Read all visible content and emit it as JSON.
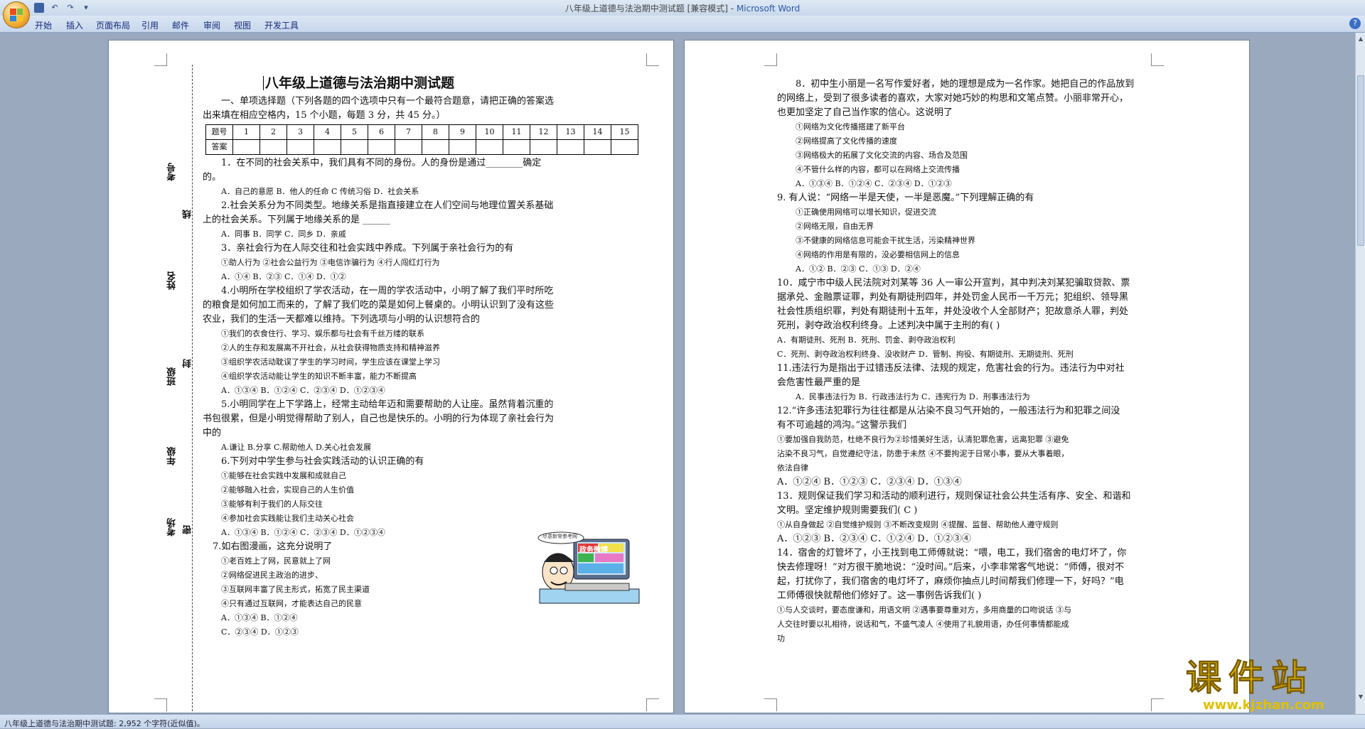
{
  "window": {
    "doc_name": "八年级上道德与法治期中测试题 [兼容模式]",
    "separator": " - ",
    "app_name": "Microsoft Word"
  },
  "menu": [
    "开始",
    "插入",
    "页面布局",
    "引用",
    "邮件",
    "审阅",
    "视图",
    "开发工具"
  ],
  "status": {
    "text": "八年级上道德与法治期中测试题: 2,952 个字符(近似值)。"
  },
  "binding": [
    "考号",
    "线",
    "姓名",
    "班级",
    "封",
    "年级",
    "考场",
    "密"
  ],
  "page1": {
    "title": "八年级上道德与法治期中测试题",
    "section1_line1": "一、单项选择题（下列各题的四个选项中只有一个最符合题意，请把正确的答案选",
    "section1_line2": "出来填在相应空格内，15 个小题，每题 3 分，共 45 分。）",
    "table_row1_head": "题号",
    "table_row2_head": "答案",
    "table_numbers": [
      "1",
      "2",
      "3",
      "4",
      "5",
      "6",
      "7",
      "8",
      "9",
      "10",
      "11",
      "12",
      "13",
      "14",
      "15"
    ],
    "q1_a": "1．在不同的社会关系中，我们具有不同的身份。人的身份是通过________确定",
    "q1_b": "的。",
    "q1_opts": "A．自己的意愿   B．他人的任命     C 传统习俗   D．社会关系",
    "q2_a": "2.社会关系分为不同类型。地缘关系是指直接建立在人们空间与地理位置关系基础",
    "q2_b": "上的社会关系。下列属于地缘关系的是 ______",
    "q2_opts": "A．同事 B．同学     C．同乡     D．亲戚",
    "q3_a": "3．亲社会行为在人际交往和社会实践中养成。下列属于亲社会行为的有",
    "q3_b": "①助人行为      ②社会公益行为      ③电信诈骗行为        ④行人闯红灯行为",
    "q3_opts": "A．①④          B．②③          C．①④          D．①②",
    "q4_a": "4.小明所在学校组织了学农活动，在一周的学农活动中，小明了解了我们平时所吃",
    "q4_b": "的粮食是如何加工而来的，了解了我们吃的菜是如何上餐桌的。小明认识到了没有这些",
    "q4_c": "农业，我们的生活一天都难以维持。下列选项与小明的认识想符合的",
    "q4_i1": "①我们的衣食住行、学习、娱乐都与社会有千丝万缕的联系",
    "q4_i2": "②人的生存和发展离不开社会，从社会获得物质支持和精神滋养",
    "q4_i3": "③组织学农活动耽误了学生的学习时间，学生应该在课堂上学习",
    "q4_i4": "④组织学农活动能让学生的知识不断丰富，能力不断提高",
    "q4_opts": "A．①③④          B．①②④          C．②③④          D．①②③④",
    "q5_a": "5.小明同学在上下学路上，经常主动给年迈和需要帮助的人让座。虽然背着沉重的",
    "q5_b": "书包很累，但是小明觉得帮助了别人，自己也是快乐的。小明的行为体现了亲社会行为",
    "q5_c": "中的",
    "q5_opts": "A.谦让         B.分享         C.帮助他人      D.关心社会发展",
    "q6_a": "6.下列对中学生参与社会实践活动的认识正确的有",
    "q6_i1": "①能够在社会实践中发展和成就自己",
    "q6_i2": "②能够融入社会，实现自己的人生价值",
    "q6_i3": "③能够有利于我们的人际交往",
    "q6_i4": "④参加社会实践能让我们主动关心社会",
    "q6_opts": "A．①③④          B．①②④          C．②③④          D．①②③④",
    "q7_a": "7.如右图漫画，这充分说明了",
    "q7_i1": "①老百姓上了网，民意就上了网",
    "q7_i2": "②网络促进民主政治的进步、",
    "q7_i3": "③互联网丰富了民主形式，拓宽了民主渠道",
    "q7_i4": "④只有通过互联网，才能表达自己的民意",
    "q7_opts1": "A．①③④             B．①②④",
    "q7_opts2": "C．②③④             D．①②③",
    "cartoon_text": "政务微博",
    "cartoon_bubble": "尽意新常参考网"
  },
  "page2": {
    "q8_a": "8．初中生小丽是一名写作爱好者，她的理想是成为一名作家。她把自己的作品放到",
    "q8_b": "的网络上，受到了很多读者的喜欢，大家对她巧妙的构思和文笔点赞。小丽非常开心，",
    "q8_c": "也更加坚定了自己当作家的信心。这说明了",
    "q8_i1": "①网络为文化传播搭建了新平台",
    "q8_i2": "②网络提高了文化传播的速度",
    "q8_i3": "③网络极大的拓展了文化交流的内容、场合及范围",
    "q8_i4": "④不管什么样的内容，都可以在网络上交流传播",
    "q8_opts": "A．①③④          B．①②④         C．②③④         D．①②③",
    "q9_a": "9. 有人说：“网络一半是天使，一半是恶魔。”下列理解正确的有",
    "q9_i1": "①正确使用网络可以增长知识，促进交流",
    "q9_i2": "②网络无限，自由无界",
    "q9_i3": "③不健康的网络信息可能会干扰生活，污染精神世界",
    "q9_i4": "④网络的作用是有限的，没必要相信网上的信息",
    "q9_opts": "A．①②       B．②③     C．①③       D．②④",
    "q10_a": "10．咸宁市中级人民法院对刘某等 36 人一审公开宣判，其中判决刘某犯骗取贷款、票",
    "q10_b": "据承兑、金融票证罪，判处有期徒刑四年，并处罚金人民币一千万元；犯组织、领导黑",
    "q10_c": "社会性质组织罪，判处有期徒刑十五年，并处没收个人全部财产；犯故意杀人罪，判处",
    "q10_d": "死刑，剥夺政治权利终身。上述判决中属于主刑的有(     )",
    "q10_o1": "A．有期徒刑、死刑 B．死刑、罚金、剥夺政治权利",
    "q10_o2": "C．死刑、剥夺政治权利终身、没收财产 D．管制、拘役、有期徒刑、无期徒刑、死刑",
    "q11_a": "11.违法行为是指出于过错违反法律、法规的规定，危害社会的行为。违法行为中对社",
    "q11_b": "会危害性最严重的是",
    "q11_opts": "A．民事违法行为    B．行政违法行为    C．违宪行为      D．刑事违法行为",
    "q12_a": "12.“许多违法犯罪行为往往都是从沾染不良习气开始的，一般违法行为和犯罪之间没",
    "q12_b": "有不可逾越的鸿沟。”这警示我们",
    "q12_c": "①要加强自我防范，杜绝不良行为②珍惜美好生活，认清犯罪危害，远离犯罪 ③避免",
    "q12_d": "沾染不良习气，自觉遵纪守法，防患于未然 ④不要拘泥于日常小事，要从大事着眼，",
    "q12_e": "依法自律",
    "q12_opts": "A．①②④              B．①②③               C．②③④              D．①③④",
    "q13_a": "13．规则保证我们学习和活动的顺利进行，规则保证社会公共生活有序、安全、和谐和",
    "q13_b": "文明。坚定维护规则需要我们( C )",
    "q13_c": "①从自身做起 ②自觉维护规则 ③不断改变规则 ④提醒、监督、帮助他人遵守规则",
    "q13_opts": "A．①②③ B．②③④ C．①②④ D．①②③④",
    "q14_a": "14．宿舍的灯管坏了，小王找到电工师傅就说：“喂，电工，我们宿舍的电灯坏了，你",
    "q14_b": "快去修理呀！”对方很干脆地说：“没时间。”后来，小李非常客气地说：“师傅，很对不",
    "q14_c": "起，打扰你了，我们宿舍的电灯坏了，麻烦你抽点儿时间帮我们修理一下，好吗？”电",
    "q14_d": "工师傅很快就帮他们修好了。这一事例告诉我们(    )",
    "q14_e": "①与人交谈时，要态度谦和，用语文明 ②遇事要尊重对方，多用商量的口吻说话 ③与",
    "q14_f": "人交往时要以礼相待，说话和气，不盛气凌人 ④使用了礼貌用语，办任何事情都能成",
    "q14_g": "功"
  },
  "watermark": {
    "big": "课件站",
    "url": "www.kjzhan.com"
  },
  "colors": {
    "app_name": "#2b58a6",
    "watermark": "#f5c800"
  }
}
